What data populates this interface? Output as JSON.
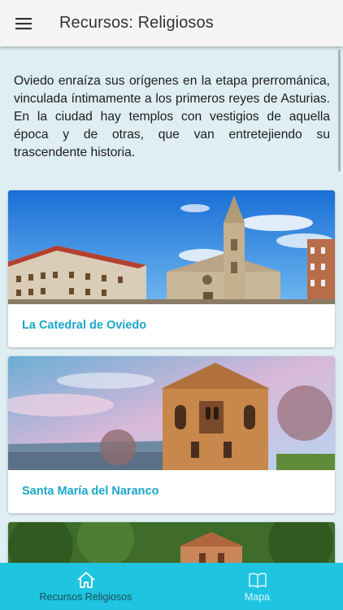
{
  "header": {
    "title": "Recursos: Religiosos",
    "menu_icon": "hamburger-menu-icon"
  },
  "intro": {
    "text": "Oviedo enraíza sus orígenes en la etapa prerrománica, vinculada íntimamente a los primeros reyes de Asturias. En la ciudad hay templos con vestigios de aquella época y de otras, que van entretejiendo su trascendente historia."
  },
  "cards": [
    {
      "title": "La Catedral de Oviedo"
    },
    {
      "title": "Santa María del Naranco"
    },
    {
      "title": ""
    }
  ],
  "bottom_nav": {
    "tabs": [
      {
        "label": "Recursos Religiosos",
        "icon": "home-icon",
        "active": true
      },
      {
        "label": "Mapa",
        "icon": "book-map-icon",
        "active": false
      }
    ]
  },
  "colors": {
    "accent": "#1ec4e0",
    "card_title": "#1aa7c9",
    "background": "#dfeef3"
  }
}
